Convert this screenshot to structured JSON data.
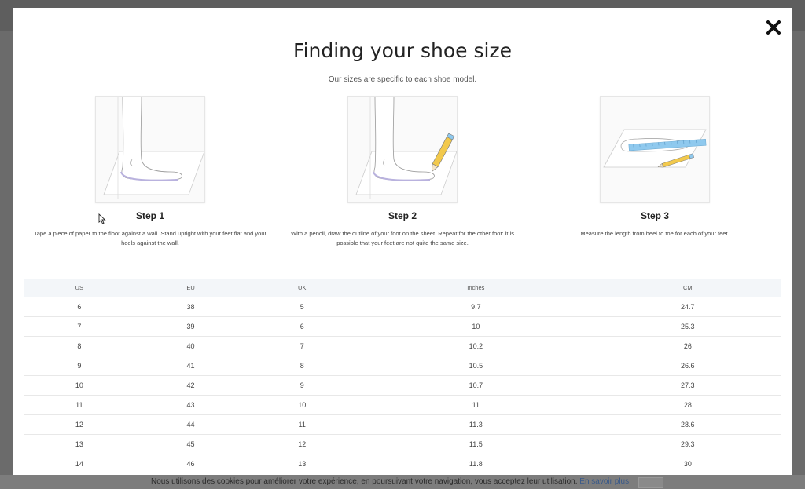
{
  "modal": {
    "title": "Finding your shoe size",
    "subtitle": "Our sizes are specific to each shoe model.",
    "close_icon": "close-icon"
  },
  "steps": [
    {
      "title": "Step 1",
      "description": "Tape a piece of paper to the floor against a wall. Stand upright with your feet flat and your heels against the wall."
    },
    {
      "title": "Step 2",
      "description": "With a pencil, draw the outline of your foot on the sheet. Repeat for the other foot: it is possible that your feet are not quite the same size."
    },
    {
      "title": "Step 3",
      "description": "Measure the length from heel to toe for each of your feet."
    }
  ],
  "size_table": {
    "headers": [
      "US",
      "EU",
      "UK",
      "Inches",
      "CM"
    ],
    "rows": [
      [
        "6",
        "38",
        "5",
        "9.7",
        "24.7"
      ],
      [
        "7",
        "39",
        "6",
        "10",
        "25.3"
      ],
      [
        "8",
        "40",
        "7",
        "10.2",
        "26"
      ],
      [
        "9",
        "41",
        "8",
        "10.5",
        "26.6"
      ],
      [
        "10",
        "42",
        "9",
        "10.7",
        "27.3"
      ],
      [
        "11",
        "43",
        "10",
        "11",
        "28"
      ],
      [
        "12",
        "44",
        "11",
        "11.3",
        "28.6"
      ],
      [
        "13",
        "45",
        "12",
        "11.5",
        "29.3"
      ],
      [
        "14",
        "46",
        "13",
        "11.8",
        "30"
      ]
    ]
  },
  "cookie_bar": {
    "text": "Nous utilisons des cookies pour améliorer votre expérience, en poursuivant votre navigation, vous acceptez leur utilisation.",
    "link": "En savoir plus"
  },
  "colors": {
    "backdrop": "#6b6b6b",
    "header_row": "#f3f6f9",
    "foot_outline": "#b9b2de",
    "ruler": "#8fc9ee",
    "pencil": "#f2c94c"
  }
}
